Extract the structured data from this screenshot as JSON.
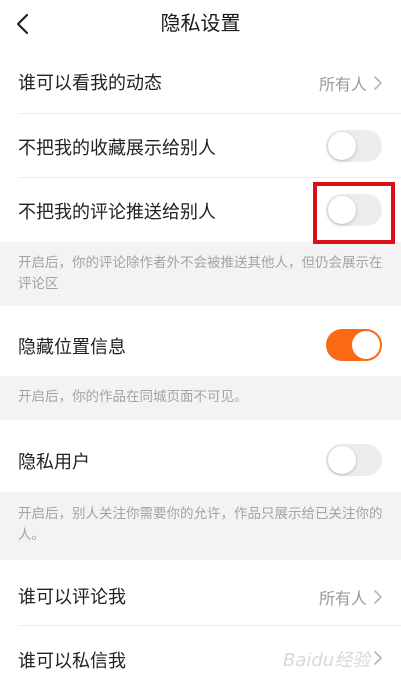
{
  "header": {
    "title": "隐私设置"
  },
  "rows": {
    "view_activity": {
      "label": "谁可以看我的动态",
      "value": "所有人"
    },
    "hide_favorites": {
      "label": "不把我的收藏展示给别人",
      "enabled": false
    },
    "hide_comments": {
      "label": "不把我的评论推送给别人",
      "enabled": false
    },
    "hide_location": {
      "label": "隐藏位置信息",
      "enabled": true
    },
    "private_user": {
      "label": "隐私用户",
      "enabled": false
    },
    "who_can_comment": {
      "label": "谁可以评论我",
      "value": "所有人"
    },
    "who_can_message": {
      "label": "谁可以私信我",
      "value": ""
    }
  },
  "notes": {
    "comments_note": "开启后，你的评论除作者外不会被推送其他人，但仍会展示在评论区",
    "location_note": "开启后，你的作品在同城页面不可见。",
    "private_note": "开启后，别人关注你需要你的允许，作品只展示给已关注你的人。"
  },
  "watermark": "Baidu经验",
  "colors": {
    "accent": "#fa6a14",
    "highlight": "#d9101a",
    "toggle_off": "#ececec",
    "note_bg": "#f3f3f3"
  },
  "icons": {
    "back": "chevron-left-icon",
    "row_arrow": "chevron-right-icon"
  }
}
